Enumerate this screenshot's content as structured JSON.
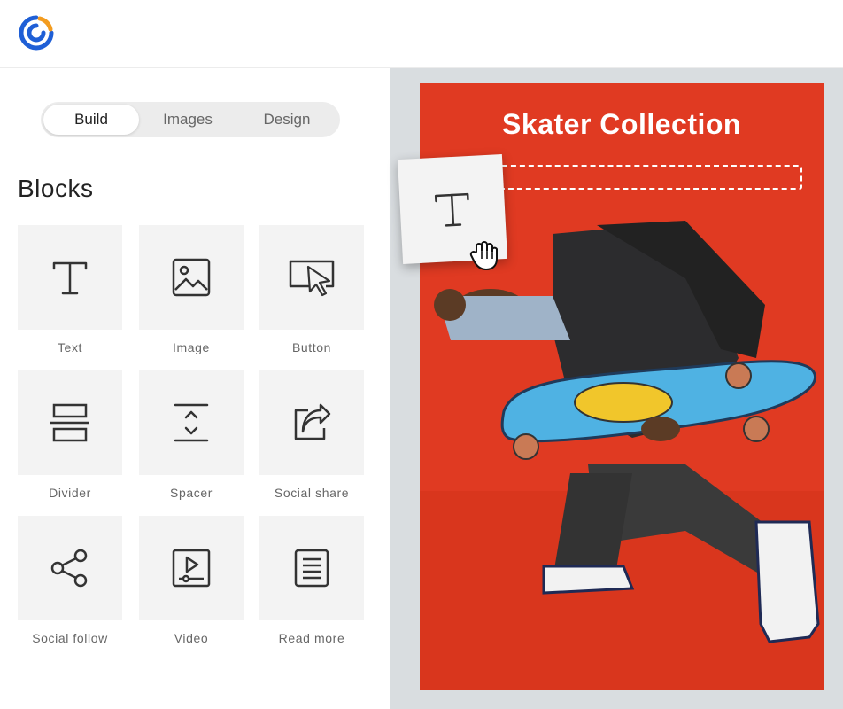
{
  "tabs": [
    {
      "label": "Build",
      "active": true
    },
    {
      "label": "Images",
      "active": false
    },
    {
      "label": "Design",
      "active": false
    }
  ],
  "blocks": {
    "title": "Blocks",
    "items": [
      {
        "label": "Text",
        "icon": "text-icon"
      },
      {
        "label": "Image",
        "icon": "image-icon"
      },
      {
        "label": "Button",
        "icon": "button-icon"
      },
      {
        "label": "Divider",
        "icon": "divider-icon"
      },
      {
        "label": "Spacer",
        "icon": "spacer-icon"
      },
      {
        "label": "Social share",
        "icon": "social-share-icon"
      },
      {
        "label": "Social follow",
        "icon": "social-follow-icon"
      },
      {
        "label": "Video",
        "icon": "video-icon"
      },
      {
        "label": "Read more",
        "icon": "read-more-icon"
      }
    ]
  },
  "canvas": {
    "headline": "Skater Collection",
    "background_color": "#e03a22",
    "dragging_block": "Text"
  },
  "colors": {
    "brand_blue": "#1f5fd6",
    "brand_orange": "#f39c1f"
  }
}
